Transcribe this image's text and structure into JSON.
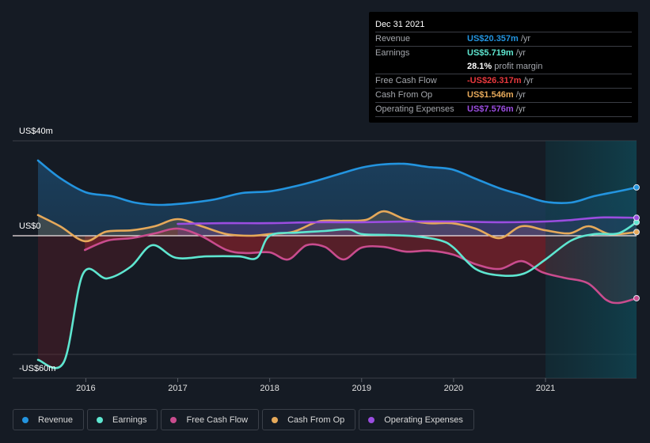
{
  "chart_data": {
    "type": "line",
    "title": "",
    "xlabel": "",
    "ylabel": "",
    "ylim": [
      -60,
      40
    ],
    "xlim": [
      2015.48,
      2021.99
    ],
    "y_tick_labels": [
      {
        "value": 40,
        "label": "US$40m"
      },
      {
        "value": 0,
        "label": "US$0"
      },
      {
        "value": -60,
        "label": "-US$60m"
      }
    ],
    "gridlines": [
      40,
      0,
      -50
    ],
    "x_ticks": [
      {
        "value": 2016,
        "label": "2016"
      },
      {
        "value": 2017,
        "label": "2017"
      },
      {
        "value": 2018,
        "label": "2018"
      },
      {
        "value": 2019,
        "label": "2019"
      },
      {
        "value": 2020,
        "label": "2020"
      },
      {
        "value": 2021,
        "label": "2021"
      }
    ],
    "highlight_region": [
      2021.0,
      2021.99
    ],
    "legend_placement": "bottom-left",
    "series": [
      {
        "name": "Revenue",
        "color": "#2394df",
        "fill": true,
        "x": [
          2015.48,
          2015.72,
          2016.0,
          2016.28,
          2016.53,
          2016.79,
          2017.09,
          2017.4,
          2017.7,
          2018.0,
          2018.26,
          2018.52,
          2018.78,
          2019.0,
          2019.21,
          2019.47,
          2019.72,
          2019.98,
          2020.24,
          2020.5,
          2020.76,
          2021.0,
          2021.28,
          2021.53,
          2021.79,
          2021.99
        ],
        "values": [
          31.7,
          24.3,
          18.3,
          16.7,
          14.0,
          13.0,
          13.7,
          15.3,
          18.0,
          18.7,
          20.7,
          23.3,
          26.3,
          28.7,
          30.0,
          30.3,
          29.0,
          28.0,
          24.0,
          20.0,
          17.0,
          14.3,
          14.0,
          16.7,
          18.7,
          20.357
        ]
      },
      {
        "name": "Earnings",
        "color": "#5ee6d0",
        "fill": false,
        "x": [
          2015.48,
          2015.76,
          2015.97,
          2016.23,
          2016.49,
          2016.72,
          2016.98,
          2017.31,
          2017.66,
          2017.86,
          2018.0,
          2018.3,
          2018.6,
          2018.86,
          2019.0,
          2019.3,
          2019.6,
          2019.86,
          2020.0,
          2020.24,
          2020.5,
          2020.76,
          2021.0,
          2021.28,
          2021.53,
          2021.79,
          2021.99
        ],
        "values": [
          -52.3,
          -53.3,
          -16.0,
          -18.0,
          -13.0,
          -4.0,
          -9.3,
          -8.7,
          -8.7,
          -9.3,
          0.0,
          1.3,
          2.0,
          2.7,
          0.7,
          0.3,
          -0.3,
          -2.0,
          -5.0,
          -14.0,
          -16.7,
          -16.0,
          -10.0,
          -2.0,
          0.7,
          1.0,
          5.719
        ]
      },
      {
        "name": "Free Cash Flow",
        "color": "#c94c8e",
        "fill": true,
        "x": [
          2015.99,
          2016.24,
          2016.5,
          2016.75,
          2017.0,
          2017.25,
          2017.53,
          2017.74,
          2018.0,
          2018.2,
          2018.4,
          2018.6,
          2018.8,
          2019.0,
          2019.24,
          2019.48,
          2019.74,
          2020.0,
          2020.24,
          2020.5,
          2020.74,
          2020.96,
          2021.2,
          2021.46,
          2021.66,
          2021.8,
          2021.99
        ],
        "values": [
          -6.0,
          -2.0,
          -1.0,
          1.0,
          3.0,
          0.0,
          -6.0,
          -7.3,
          -7.0,
          -10.0,
          -4.0,
          -4.7,
          -10.0,
          -5.0,
          -4.7,
          -6.7,
          -6.3,
          -8.0,
          -12.0,
          -14.0,
          -10.7,
          -15.3,
          -17.7,
          -20.0,
          -27.0,
          -28.3,
          -26.317
        ]
      },
      {
        "name": "Cash From Op",
        "color": "#e6a95a",
        "fill": true,
        "x": [
          2015.48,
          2015.72,
          2015.99,
          2016.22,
          2016.5,
          2016.75,
          2017.0,
          2017.26,
          2017.53,
          2017.8,
          2018.0,
          2018.26,
          2018.53,
          2018.8,
          2019.05,
          2019.24,
          2019.47,
          2019.72,
          2019.98,
          2020.24,
          2020.5,
          2020.74,
          2021.0,
          2021.26,
          2021.47,
          2021.7,
          2021.99
        ],
        "values": [
          8.7,
          4.0,
          -2.3,
          1.7,
          2.3,
          4.0,
          7.0,
          4.0,
          0.7,
          0.0,
          0.7,
          1.7,
          6.0,
          6.3,
          6.7,
          10.3,
          7.0,
          5.3,
          5.3,
          3.0,
          -1.0,
          4.0,
          2.3,
          1.0,
          4.0,
          0.7,
          1.546
        ]
      },
      {
        "name": "Operating Expenses",
        "color": "#9b4de0",
        "fill": true,
        "x": [
          2017.0,
          2017.5,
          2018.0,
          2018.5,
          2019.0,
          2019.5,
          2020.0,
          2020.5,
          2021.0,
          2021.3,
          2021.6,
          2021.99
        ],
        "values": [
          5.0,
          5.3,
          5.3,
          5.7,
          5.7,
          6.0,
          6.0,
          5.7,
          6.0,
          6.7,
          7.7,
          7.576
        ]
      }
    ]
  },
  "tooltip": {
    "date": "Dec 31 2021",
    "rows": [
      {
        "key": "Revenue",
        "value": "US$20.357m",
        "unit": "/yr",
        "color": "#2394df"
      },
      {
        "key": "Earnings",
        "value": "US$5.719m",
        "unit": "/yr",
        "color": "#5ee6d0"
      },
      {
        "key": "",
        "value": "28.1%",
        "unit": "profit margin",
        "color": "#ffffff"
      },
      {
        "key": "Free Cash Flow",
        "value": "-US$26.317m",
        "unit": "/yr",
        "color": "#e8383d"
      },
      {
        "key": "Cash From Op",
        "value": "US$1.546m",
        "unit": "/yr",
        "color": "#e6a95a"
      },
      {
        "key": "Operating Expenses",
        "value": "US$7.576m",
        "unit": "/yr",
        "color": "#9b4de0"
      }
    ]
  },
  "legend": [
    {
      "label": "Revenue",
      "color": "#2394df"
    },
    {
      "label": "Earnings",
      "color": "#5ee6d0"
    },
    {
      "label": "Free Cash Flow",
      "color": "#c94c8e"
    },
    {
      "label": "Cash From Op",
      "color": "#e6a95a"
    },
    {
      "label": "Operating Expenses",
      "color": "#9b4de0"
    }
  ]
}
